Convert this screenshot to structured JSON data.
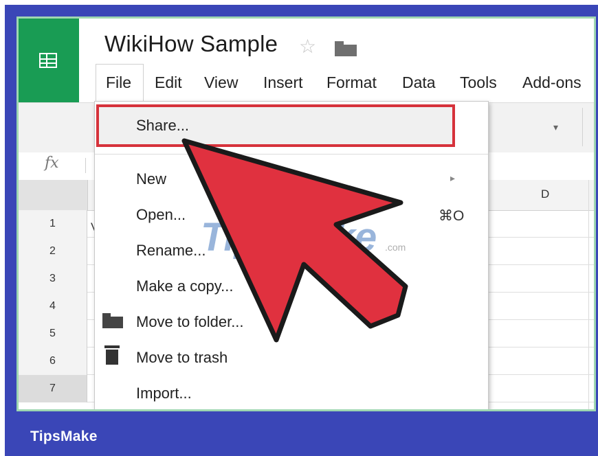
{
  "document": {
    "title": "WikiHow Sample"
  },
  "menubar": {
    "items": [
      "File",
      "Edit",
      "View",
      "Insert",
      "Format",
      "Data",
      "Tools",
      "Add-ons"
    ]
  },
  "formula_bar": {
    "fx_label": "fx"
  },
  "columns": {
    "d_label": "D"
  },
  "rows": [
    "1",
    "2",
    "3",
    "4",
    "5",
    "6",
    "7"
  ],
  "row1_cell": "V",
  "file_menu": {
    "share": "Share...",
    "new": "New",
    "new_arrow": "▸",
    "open": "Open...",
    "open_shortcut": "⌘O",
    "rename": "Rename...",
    "make_copy": "Make a copy...",
    "move_to_folder": "Move to folder...",
    "move_to_trash": "Move to trash",
    "import": "Import..."
  },
  "watermark": {
    "text": "TipsMake",
    "sub": ".com"
  },
  "caption": "TipsMake",
  "colors": {
    "accent_green": "#199c54",
    "highlight_red": "#d6323b",
    "arrow_red": "#e0313f",
    "frame_blue": "#3a46b7"
  },
  "icons": [
    "sheets-logo-icon",
    "star-icon",
    "folder-icon",
    "move-folder-icon",
    "trash-icon",
    "submenu-arrow-icon",
    "pointer-arrow-icon"
  ]
}
